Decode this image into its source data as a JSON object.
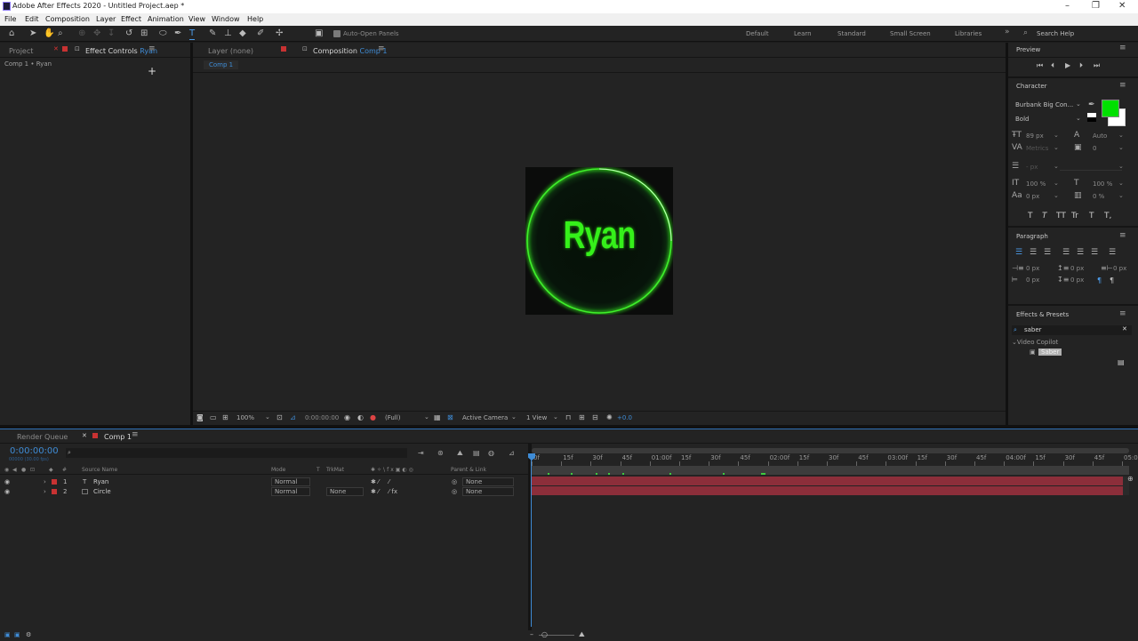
{
  "app": {
    "title": "Adobe After Effects 2020 - Untitled Project.aep *"
  },
  "menu": [
    "File",
    "Edit",
    "Composition",
    "Layer",
    "Effect",
    "Animation",
    "View",
    "Window",
    "Help"
  ],
  "toolbar": {
    "auto_open_panels": "Auto-Open Panels",
    "workspaces": [
      "Default",
      "Learn",
      "Standard",
      "Small Screen",
      "Libraries"
    ],
    "search_help": "Search Help"
  },
  "left_panel": {
    "tab_project": "Project",
    "tab_effect_controls": "Effect Controls",
    "effect_controls_target": "Ryan",
    "breadcrumb": "Comp 1 • Ryan"
  },
  "center_panel": {
    "tab_layer": "Layer  (none)",
    "tab_composition": "Composition",
    "comp_name": "Comp 1",
    "comp_subtab": "Comp 1",
    "viewer_text": "Ryan",
    "accent_color": "#35f01a",
    "footer": {
      "zoom": "100%",
      "timecode": "0:00:00:00",
      "resolution": "(Full)",
      "camera": "Active Camera",
      "views": "1 View",
      "exposure": "+0.0"
    }
  },
  "right_panel": {
    "preview_title": "Preview",
    "character_title": "Character",
    "font_name": "Burbank Big Con...",
    "font_style": "Bold",
    "fill_color": "#00e000",
    "font_size": "89 px",
    "leading": "Auto",
    "kerning": "Metrics",
    "tracking": "0",
    "stroke_width": "- px",
    "vert_scale": "100 %",
    "horiz_scale": "100 %",
    "baseline": "0 px",
    "tsume": "0 %",
    "text_styles": [
      "T",
      "T",
      "TT",
      "Tr",
      "T",
      "T,"
    ],
    "paragraph_title": "Paragraph",
    "indent_values": [
      "0 px",
      "0 px",
      "0 px",
      "0 px",
      "0 px"
    ],
    "effects_title": "Effects & Presets",
    "search_value": "saber",
    "effects_category": "Video Copilot",
    "effects_item": "Saber"
  },
  "timeline": {
    "tab_render_queue": "Render Queue",
    "tab_comp": "Comp 1",
    "timecode": "0:00:00:00",
    "timecode_sub": "00000 (30.00 fps)",
    "columns": {
      "num": "#",
      "source": "Source Name",
      "mode": "Mode",
      "t": "T",
      "trkmat": "TrkMat",
      "parent": "Parent & Link"
    },
    "layers": [
      {
        "num": "1",
        "type": "T",
        "name": "Ryan",
        "mode": "Normal",
        "trkmat": "",
        "parent": "None"
      },
      {
        "num": "2",
        "type": "",
        "name": "Circle",
        "mode": "Normal",
        "trkmat": "None",
        "parent": "None"
      }
    ],
    "ruler": [
      "0f",
      "15f",
      "30f",
      "45f",
      "01:00f",
      "15f",
      "30f",
      "45f",
      "02:00f",
      "15f",
      "30f",
      "45f",
      "03:00f",
      "15f",
      "30f",
      "45f",
      "04:00f",
      "15f",
      "30f",
      "45f",
      "05:0"
    ]
  }
}
